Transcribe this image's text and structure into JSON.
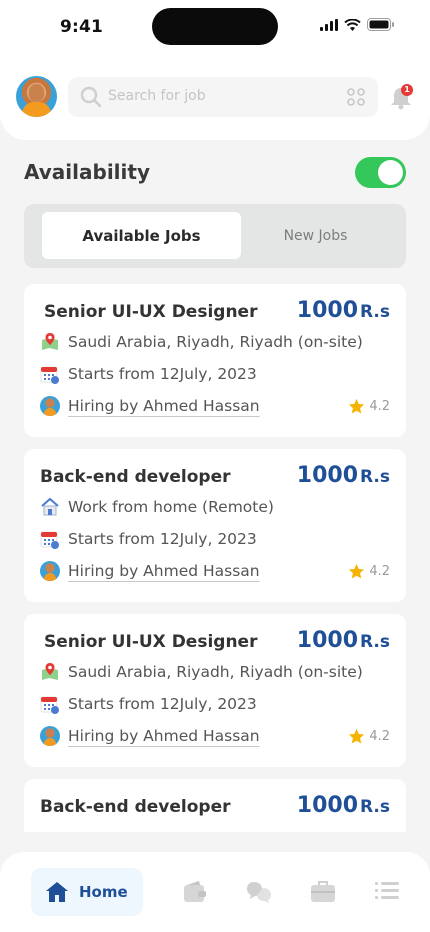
{
  "status_bar": {
    "time": "9:41"
  },
  "header": {
    "search_placeholder": "Search for job",
    "notification_count": "1"
  },
  "availability": {
    "title": "Availability",
    "enabled": true
  },
  "tabs": [
    {
      "label": "Available Jobs",
      "active": true
    },
    {
      "label": "New Jobs",
      "active": false
    }
  ],
  "jobs": [
    {
      "title": "Senior UI-UX Designer",
      "price": "1000",
      "currency": "R.s",
      "location": "Saudi Arabia, Riyadh, Riyadh (on-site)",
      "location_icon": "map-pin-icon",
      "start": "Starts from 12July, 2023",
      "hiring": "Hiring by Ahmed Hassan",
      "rating": "4.2"
    },
    {
      "title": "Back-end developer",
      "price": "1000",
      "currency": "R.s",
      "location": "Work from home (Remote)",
      "location_icon": "home-icon",
      "start": "Starts from 12July, 2023",
      "hiring": "Hiring by Ahmed Hassan",
      "rating": "4.2"
    },
    {
      "title": "Senior UI-UX Designer",
      "price": "1000",
      "currency": "R.s",
      "location": "Saudi Arabia, Riyadh, Riyadh (on-site)",
      "location_icon": "map-pin-icon",
      "start": "Starts from 12July, 2023",
      "hiring": "Hiring by Ahmed Hassan",
      "rating": "4.2"
    },
    {
      "title": "Back-end developer",
      "price": "1000",
      "currency": "R.s"
    }
  ],
  "bottom_nav": {
    "home_label": "Home",
    "items": [
      "home-icon",
      "wallet-icon",
      "chat-icon",
      "briefcase-icon",
      "menu-icon"
    ]
  },
  "colors": {
    "accent": "#1f4f96",
    "toggle_on": "#34c759",
    "star": "#f5b400",
    "badge": "#e53935"
  }
}
